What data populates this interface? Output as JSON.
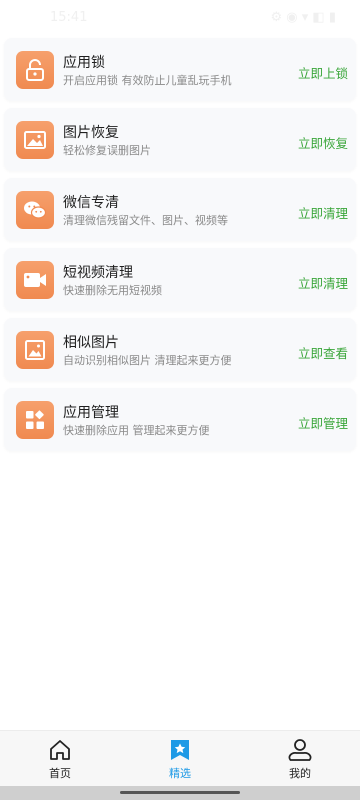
{
  "status_bar": {
    "time": "15:41",
    "icons": "⚙ ◉ ▾ ◧ ▮"
  },
  "cards": [
    {
      "title": "应用锁",
      "desc": "开启应用锁 有效防止儿童乱玩手机",
      "action": "立即上锁",
      "icon": "lock-open-icon"
    },
    {
      "title": "图片恢复",
      "desc": "轻松修复误删图片",
      "action": "立即恢复",
      "icon": "image-icon"
    },
    {
      "title": "微信专清",
      "desc": "清理微信残留文件、图片、视频等",
      "action": "立即清理",
      "icon": "wechat-icon"
    },
    {
      "title": "短视频清理",
      "desc": "快速删除无用短视频",
      "action": "立即清理",
      "icon": "video-camera-icon"
    },
    {
      "title": "相似图片",
      "desc": "自动识别相似图片 清理起来更方便",
      "action": "立即查看",
      "icon": "similar-image-icon"
    },
    {
      "title": "应用管理",
      "desc": "快速删除应用 管理起来更方便",
      "action": "立即管理",
      "icon": "apps-grid-icon"
    }
  ],
  "tabs": [
    {
      "label": "首页",
      "icon": "home-icon",
      "active": false
    },
    {
      "label": "精选",
      "icon": "bookmark-star-icon",
      "active": true
    },
    {
      "label": "我的",
      "icon": "user-icon",
      "active": false
    }
  ],
  "colors": {
    "accent_orange": "#f08a50",
    "action_green": "#3aa63a",
    "tab_active": "#1e9ae6"
  }
}
